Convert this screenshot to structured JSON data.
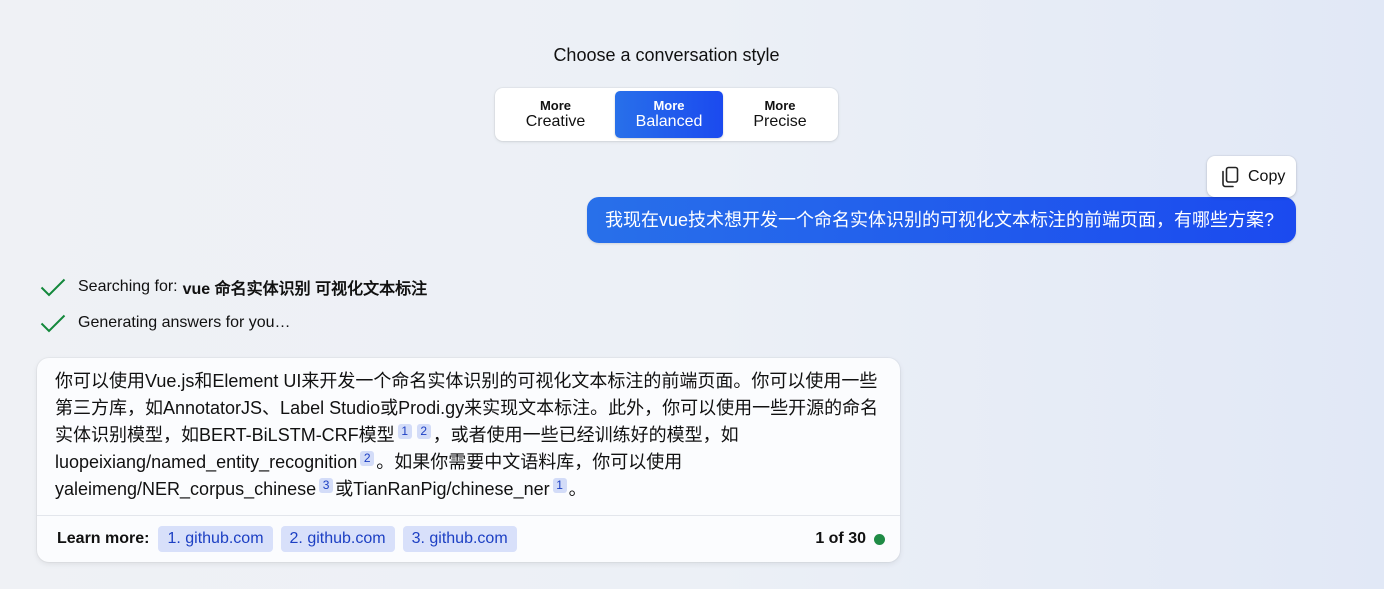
{
  "style_picker": {
    "heading": "Choose a conversation style",
    "options": [
      {
        "prefix": "More",
        "label": "Creative",
        "selected": false
      },
      {
        "prefix": "More",
        "label": "Balanced",
        "selected": true
      },
      {
        "prefix": "More",
        "label": "Precise",
        "selected": false
      }
    ]
  },
  "user_message": {
    "copy_label": "Copy",
    "copy_icon": "copy-icon",
    "text": "我现在vue技术想开发一个命名实体识别的可视化文本标注的前端页面，有哪些方案?"
  },
  "progress": [
    {
      "icon": "checkmark-icon",
      "label": "Searching for:",
      "query": "vue 命名实体识别 可视化文本标注"
    },
    {
      "icon": "checkmark-icon",
      "label": "Generating answers for you…"
    }
  ],
  "answer": {
    "lines": [
      [
        {
          "text": "你可以使用Vue.js和Element UI来开发一个命名实体识别的可视化文本标注的前端页面。你可以使用一些"
        }
      ],
      [
        {
          "text": "第三方库，如AnnotatorJS、Label Studio或Prodi.gy来实现文本标注。此外，你可以使用一些开源的命名"
        }
      ],
      [
        {
          "text": "实体识别模型，如BERT-BiLSTM-CRF模型"
        },
        {
          "cite": "1"
        },
        {
          "cite": "2"
        },
        {
          "text": "，或者使用一些已经训练好的模型，如"
        }
      ],
      [
        {
          "text": "luopeixiang/named_entity_recognition"
        },
        {
          "cite": "2"
        },
        {
          "text": "。如果你需要中文语料库，你可以使用"
        }
      ],
      [
        {
          "text": "yaleimeng/NER_corpus_chinese"
        },
        {
          "cite": "3"
        },
        {
          "text": "或TianRanPig/chinese_ner"
        },
        {
          "cite": "1"
        },
        {
          "text": "。"
        }
      ]
    ],
    "learn_more_label": "Learn more:",
    "sources": [
      "1. github.com",
      "2. github.com",
      "3. github.com"
    ],
    "turn_counter": "1 of 30",
    "status_icon": "status-dot-icon"
  },
  "colors": {
    "accent_start": "#2870ea",
    "accent_end": "#1b4aef",
    "success": "#13883b",
    "status_dot": "#1f8b45",
    "chip_bg": "#d8e0fa",
    "cite_bg": "#d3dcf8",
    "link": "#1c3fc3"
  }
}
